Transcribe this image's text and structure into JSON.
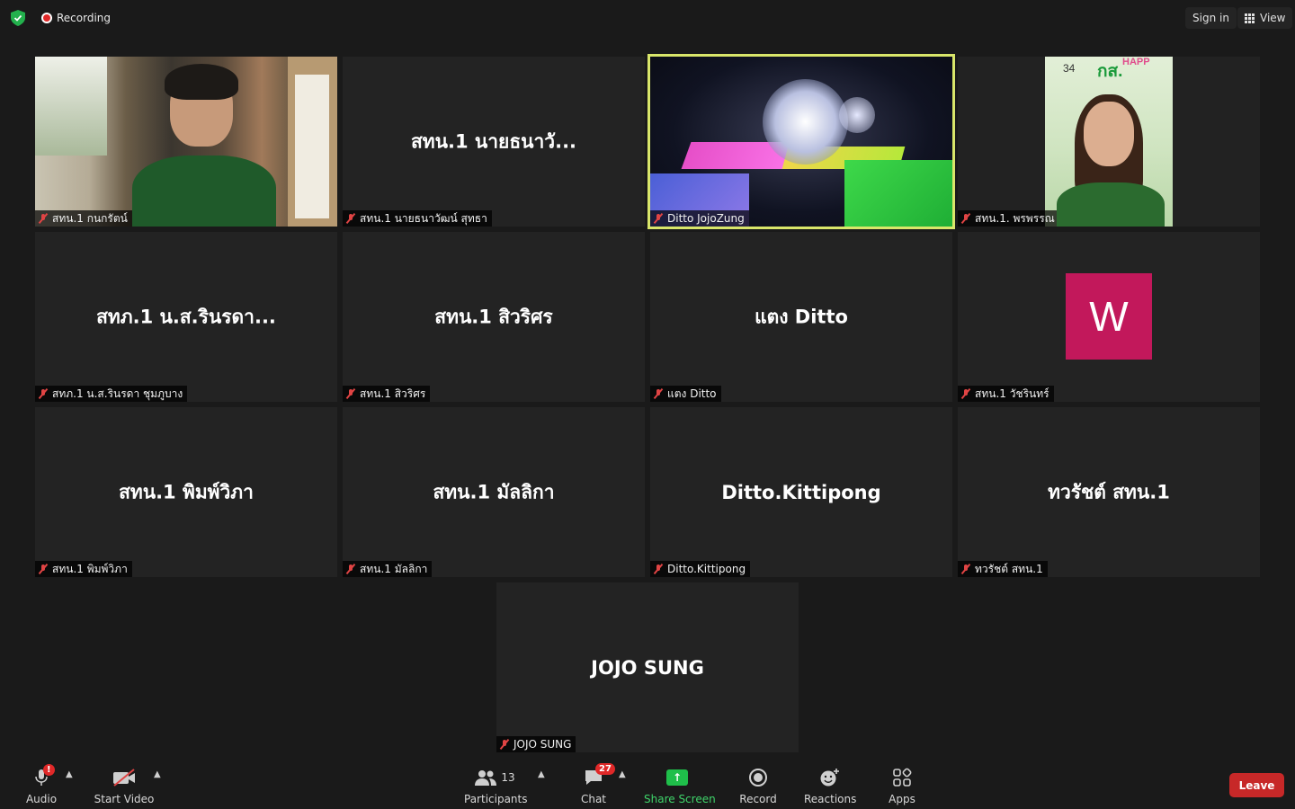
{
  "topbar": {
    "recording_label": "Recording",
    "signin_label": "Sign in",
    "view_label": "View"
  },
  "tiles": [
    {
      "display": "",
      "label": "สทน.1 กนกรัตน์"
    },
    {
      "display": "สทน.1 นายธนาวั...",
      "label": "สทน.1 นายธนาวัฒน์ สุทธา"
    },
    {
      "display": "",
      "label": "Ditto JojoZung"
    },
    {
      "display": "",
      "label": "สทน.1. พรพรรณ"
    },
    {
      "display": "สทภ.1 น.ส.รินรดา...",
      "label": "สทภ.1 น.ส.รินรดา ชุมภูบาง"
    },
    {
      "display": "สทน.1 สิวริศร",
      "label": "สทน.1 สิวริศร"
    },
    {
      "display": "แตง Ditto",
      "label": "แตง Ditto"
    },
    {
      "display": "W",
      "label": "สทน.1 วัชรินทร์"
    },
    {
      "display": "สทน.1 พิมพ์วิภา",
      "label": "สทน.1 พิมพ์วิภา"
    },
    {
      "display": "สทน.1 มัลลิกา",
      "label": "สทน.1 มัลลิกา"
    },
    {
      "display": "Ditto.Kittipong",
      "label": "Ditto.Kittipong"
    },
    {
      "display": "ทวรัชต์ สทน.1",
      "label": "ทวรัชต์ สทน.1"
    },
    {
      "display": "JOJO SUNG",
      "label": "JOJO SUNG"
    }
  ],
  "video_overlay": {
    "number": "34",
    "brand": "กส.",
    "brand_suffix": "HAPP"
  },
  "toolbar": {
    "audio_label": "Audio",
    "audio_badge": "!",
    "video_label": "Start Video",
    "participants_label": "Participants",
    "participants_count": "13",
    "chat_label": "Chat",
    "chat_badge": "27",
    "share_label": "Share Screen",
    "record_label": "Record",
    "reactions_label": "Reactions",
    "apps_label": "Apps",
    "leave_label": "Leave"
  },
  "colors": {
    "active_speaker": "#d9e66a",
    "share_green": "#1fbf4a",
    "leave_red": "#c72828",
    "avatar_w": "#c2185b"
  }
}
